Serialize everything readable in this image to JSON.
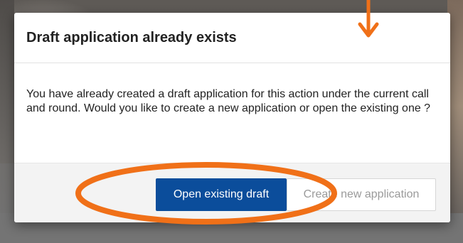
{
  "dialog": {
    "title": "Draft application already exists",
    "message": "You have already created a draft application for this action under the current call and round. Would you like to create a new application or open the existing one ?",
    "buttons": {
      "open_existing": "Open existing draft",
      "create_new": "Create new application"
    }
  },
  "colors": {
    "primary_button": "#0b4d9b",
    "annotation": "#f07018"
  },
  "annotations": {
    "arrow_icon": "down-arrow-icon",
    "highlight": "ellipse-highlight"
  }
}
